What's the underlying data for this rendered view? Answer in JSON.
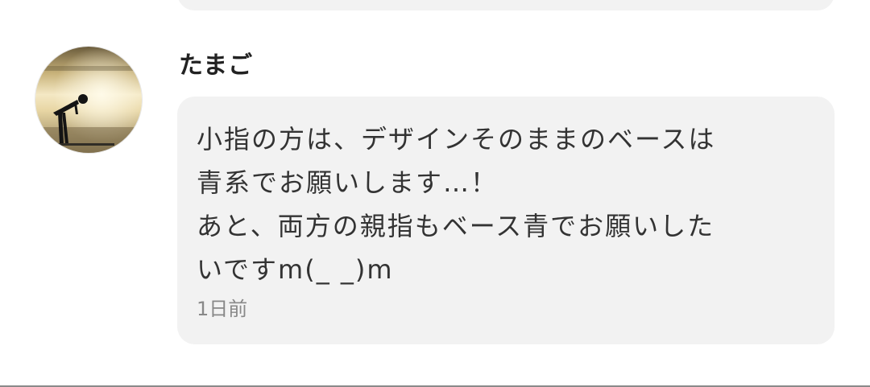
{
  "comment": {
    "username": "たまご",
    "avatar_icon": "user-avatar-silhouette-sunset",
    "message_lines": [
      "小指の方は、デザインそのままのベースは",
      "青系でお願いします…！",
      "あと、両方の親指もベース青でお願いした",
      "いですm(_ _)m"
    ],
    "timestamp": "1日前"
  },
  "colors": {
    "bubble_background": "#f2f2f2",
    "text": "#333333",
    "timestamp": "#888888"
  }
}
